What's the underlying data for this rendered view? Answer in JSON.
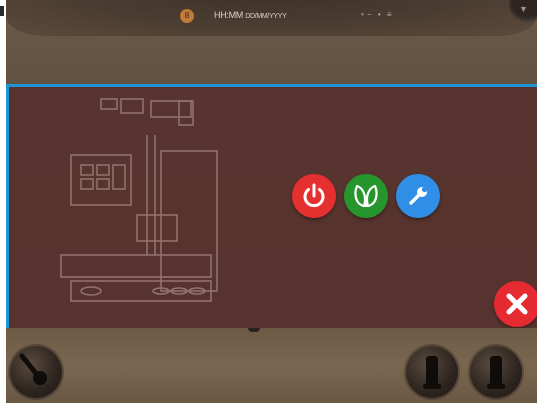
{
  "status_bar": {
    "time_label": "HH:MM",
    "date_label": "DD/MM/YYYY",
    "badge_text": "8",
    "status_icons_text": "∘− •  ≡"
  },
  "menu": {
    "buttons": [
      {
        "id": "power",
        "icon": "power-icon",
        "color": "#e53030"
      },
      {
        "id": "eco",
        "icon": "leaf-icon",
        "color": "#26952c"
      },
      {
        "id": "maintenance",
        "icon": "wrench-icon",
        "color": "#2f8fe6"
      }
    ],
    "close": {
      "icon": "close-icon",
      "color": "#e62a32"
    }
  },
  "colors": {
    "overlay": "#57322e",
    "overlay_border": "#1f95d8",
    "background": "#5a4b3d"
  }
}
